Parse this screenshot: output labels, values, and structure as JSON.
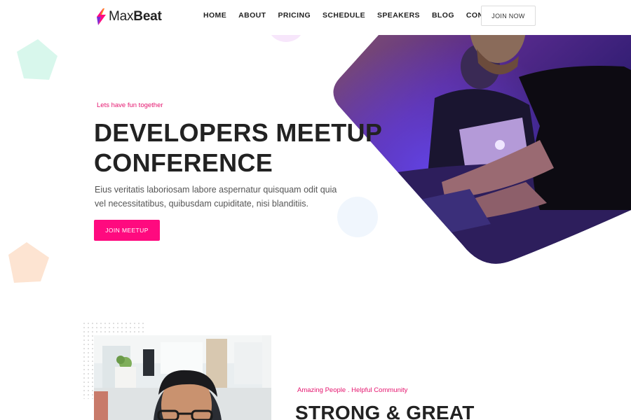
{
  "header": {
    "logo": {
      "text_light": "Max",
      "text_bold": "Beat",
      "icon": "maxbeat-logo-icon"
    },
    "nav": [
      "HOME",
      "ABOUT",
      "PRICING",
      "SCHEDULE",
      "SPEAKERS",
      "BLOG",
      "CONTACT"
    ],
    "cta": "JOIN NOW"
  },
  "hero": {
    "tagline": "Lets have fun together",
    "title_line1": "DEVELOPERS MEETUP",
    "title_line2": "CONFERENCE",
    "description": "Eius veritatis laboriosam labore aspernatur quisquam odit quia vel necessitatibus, quibusdam cupiditate, nisi blanditiis.",
    "cta": "JOIN MEETUP",
    "image": "developers-at-laptops-photo"
  },
  "about": {
    "tagline": "Amazing People . Helpful Community",
    "title": "STRONG & GREAT",
    "image": "smiling-man-with-glasses-photo"
  },
  "colors": {
    "accent": "#ff0a7f",
    "tagline": "#e5166f",
    "mint_shape": "#d8f7ec",
    "peach_shape": "#fde4d2",
    "lilac_shape": "#f7e6fb",
    "blue_shape": "#f0f6fd"
  }
}
